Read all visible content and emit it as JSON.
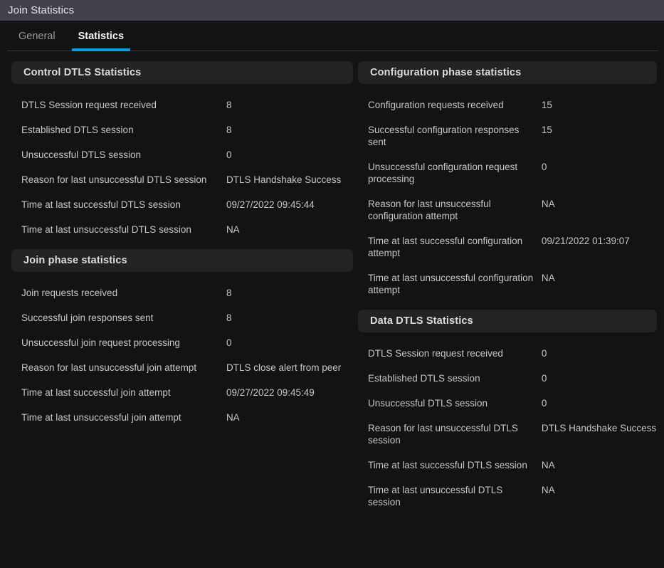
{
  "window": {
    "title": "Join Statistics"
  },
  "tabs": [
    {
      "label": "General",
      "active": false
    },
    {
      "label": "Statistics",
      "active": true
    }
  ],
  "colors": {
    "titlebar_bg": "#41414c",
    "page_bg": "#131313",
    "section_header_bg": "#232325",
    "accent": "#0d9ee0",
    "text": "#c6c6c6",
    "tab_inactive": "#9a9a9a"
  },
  "left_column": [
    {
      "title": "Control DTLS Statistics",
      "rows": [
        {
          "label": "DTLS Session request received",
          "value": "8"
        },
        {
          "label": "Established DTLS session",
          "value": "8"
        },
        {
          "label": "Unsuccessful DTLS session",
          "value": "0"
        },
        {
          "label": "Reason for last unsuccessful DTLS session",
          "value": "DTLS Handshake Success"
        },
        {
          "label": "Time at last successful DTLS session",
          "value": "09/27/2022 09:45:44"
        },
        {
          "label": "Time at last unsuccessful DTLS session",
          "value": "NA"
        }
      ]
    },
    {
      "title": "Join phase statistics",
      "rows": [
        {
          "label": "Join requests received",
          "value": "8"
        },
        {
          "label": "Successful join responses sent",
          "value": "8"
        },
        {
          "label": "Unsuccessful join request processing",
          "value": "0"
        },
        {
          "label": "Reason for last unsuccessful join attempt",
          "value": "DTLS close alert from peer"
        },
        {
          "label": "Time at last successful join attempt",
          "value": "09/27/2022 09:45:49"
        },
        {
          "label": "Time at last unsuccessful join attempt",
          "value": "NA"
        }
      ]
    }
  ],
  "right_column": [
    {
      "title": "Configuration phase statistics",
      "rows": [
        {
          "label": "Configuration requests received",
          "value": "15"
        },
        {
          "label": "Successful configuration responses sent",
          "value": "15"
        },
        {
          "label": "Unsuccessful configuration request processing",
          "value": "0"
        },
        {
          "label": "Reason for last unsuccessful configuration attempt",
          "value": "NA"
        },
        {
          "label": "Time at last successful configuration attempt",
          "value": "09/21/2022 01:39:07"
        },
        {
          "label": "Time at last unsuccessful configuration attempt",
          "value": "NA"
        }
      ]
    },
    {
      "title": "Data DTLS Statistics",
      "rows": [
        {
          "label": "DTLS Session request received",
          "value": "0"
        },
        {
          "label": "Established DTLS session",
          "value": "0"
        },
        {
          "label": "Unsuccessful DTLS session",
          "value": "0"
        },
        {
          "label": "Reason for last unsuccessful DTLS session",
          "value": "DTLS Handshake Success"
        },
        {
          "label": "Time at last successful DTLS session",
          "value": "NA"
        },
        {
          "label": "Time at last unsuccessful DTLS session",
          "value": "NA"
        }
      ]
    }
  ]
}
